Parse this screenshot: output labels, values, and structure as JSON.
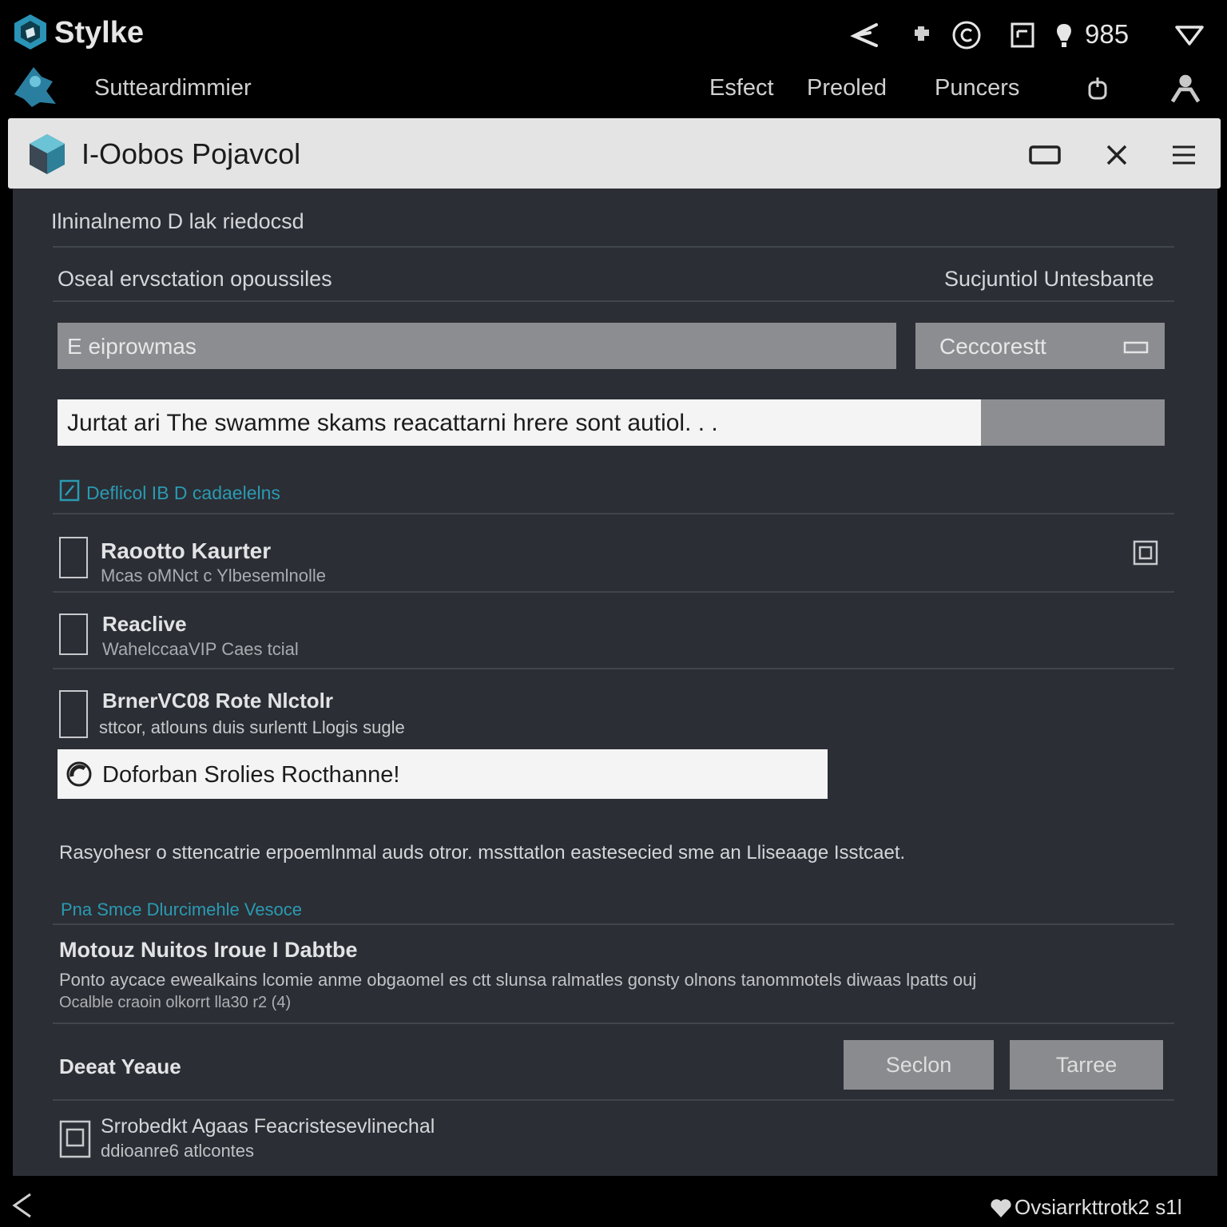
{
  "app": {
    "title": "Stylke",
    "subtitle": "Sutteardimmier",
    "notification_count": "985"
  },
  "top_nav": [
    "Esfect",
    "Preoled",
    "Puncers"
  ],
  "window": {
    "title": "I-Oobos Pojavcol"
  },
  "content": {
    "heading": "Ilninalnemo D lak riedocsd",
    "section_label": "Oseal ervsctation opoussiles",
    "section_right": "Sucjuntiol Untesbante",
    "search_input_value": "E eiprowmas",
    "select_value": "Ceccorestt",
    "message_input_value": "Jurtat ari The swamme skams reacattarni hrere sont autiol. . .",
    "link_label": "Deflicol IB D cadaelelns",
    "items": [
      {
        "title": "Raootto Kaurter",
        "subtitle": "Mcas oMNct c Ylbesemlnolle"
      },
      {
        "title": "Reaclive",
        "subtitle": "WahelccaaVIP Caes tcial"
      },
      {
        "title": "BrnerVC08 Rote Nlctolr",
        "subtitle": "sttcor, atlouns duis surlentt Llogis sugle"
      }
    ],
    "highlight_field": "Doforban Srolies Rocthanne!",
    "paragraph": "Rasyohesr o sttencatrie erpoemlnmal auds otror. mssttatlon eastesecied sme an Lliseaage Isstcaet.",
    "link2": "Pna Smce Dlurcimehle Vesoce",
    "bold_heading": "Motouz Nuitos Iroue I Dabtbe",
    "desc_line1": "Ponto aycace ewealkains lcomie anme obgaomel es ctt slunsa ralmatles gonsty olnons tanommotels diwaas lpatts ouj",
    "desc_line2": "Ocalble craoin olkorrt lla30 r2 (4)",
    "footer_label": "Deeat Yeaue",
    "btn_section": "Seclon",
    "btn_terre": "Tarree",
    "last_item_title": "Srrobedkt Agaas Feacristesevlinechal",
    "last_item_sub": "ddioanre6 atlcontes"
  },
  "status_bar": {
    "label": "Ovsiarrkttrotk2 s1l"
  },
  "colors": {
    "accent": "#2a9ab3",
    "window_bg": "#2b2e34",
    "titlebar_bg": "#e4e4e4"
  },
  "icons": [
    "brand-logo-icon",
    "share-icon",
    "puzzle-icon",
    "copyright-icon",
    "document-icon",
    "bulb-icon",
    "chevron-down-icon",
    "gesture-icon",
    "user-icon",
    "window-logo-icon",
    "maximize-icon",
    "close-icon",
    "menu-icon",
    "edit-icon",
    "expand-icon",
    "spinner-icon",
    "document-icon",
    "back-icon",
    "heart-icon"
  ]
}
